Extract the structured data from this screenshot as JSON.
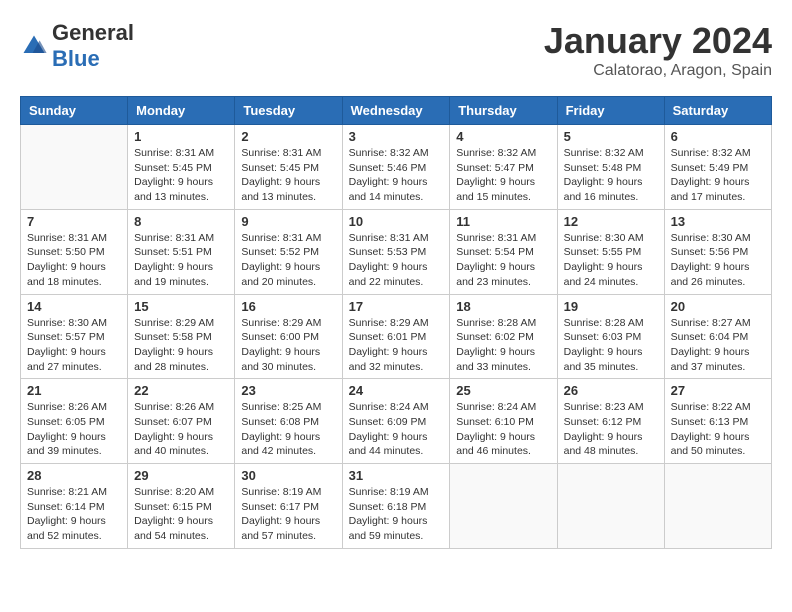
{
  "logo": {
    "general": "General",
    "blue": "Blue"
  },
  "header": {
    "month": "January 2024",
    "location": "Calatorao, Aragon, Spain"
  },
  "days_of_week": [
    "Sunday",
    "Monday",
    "Tuesday",
    "Wednesday",
    "Thursday",
    "Friday",
    "Saturday"
  ],
  "weeks": [
    [
      {
        "day": "",
        "info": ""
      },
      {
        "day": "1",
        "sunrise": "Sunrise: 8:31 AM",
        "sunset": "Sunset: 5:45 PM",
        "daylight": "Daylight: 9 hours and 13 minutes."
      },
      {
        "day": "2",
        "sunrise": "Sunrise: 8:31 AM",
        "sunset": "Sunset: 5:45 PM",
        "daylight": "Daylight: 9 hours and 13 minutes."
      },
      {
        "day": "3",
        "sunrise": "Sunrise: 8:32 AM",
        "sunset": "Sunset: 5:46 PM",
        "daylight": "Daylight: 9 hours and 14 minutes."
      },
      {
        "day": "4",
        "sunrise": "Sunrise: 8:32 AM",
        "sunset": "Sunset: 5:47 PM",
        "daylight": "Daylight: 9 hours and 15 minutes."
      },
      {
        "day": "5",
        "sunrise": "Sunrise: 8:32 AM",
        "sunset": "Sunset: 5:48 PM",
        "daylight": "Daylight: 9 hours and 16 minutes."
      },
      {
        "day": "6",
        "sunrise": "Sunrise: 8:32 AM",
        "sunset": "Sunset: 5:49 PM",
        "daylight": "Daylight: 9 hours and 17 minutes."
      }
    ],
    [
      {
        "day": "7",
        "sunrise": "Sunrise: 8:31 AM",
        "sunset": "Sunset: 5:50 PM",
        "daylight": "Daylight: 9 hours and 18 minutes."
      },
      {
        "day": "8",
        "sunrise": "Sunrise: 8:31 AM",
        "sunset": "Sunset: 5:51 PM",
        "daylight": "Daylight: 9 hours and 19 minutes."
      },
      {
        "day": "9",
        "sunrise": "Sunrise: 8:31 AM",
        "sunset": "Sunset: 5:52 PM",
        "daylight": "Daylight: 9 hours and 20 minutes."
      },
      {
        "day": "10",
        "sunrise": "Sunrise: 8:31 AM",
        "sunset": "Sunset: 5:53 PM",
        "daylight": "Daylight: 9 hours and 22 minutes."
      },
      {
        "day": "11",
        "sunrise": "Sunrise: 8:31 AM",
        "sunset": "Sunset: 5:54 PM",
        "daylight": "Daylight: 9 hours and 23 minutes."
      },
      {
        "day": "12",
        "sunrise": "Sunrise: 8:30 AM",
        "sunset": "Sunset: 5:55 PM",
        "daylight": "Daylight: 9 hours and 24 minutes."
      },
      {
        "day": "13",
        "sunrise": "Sunrise: 8:30 AM",
        "sunset": "Sunset: 5:56 PM",
        "daylight": "Daylight: 9 hours and 26 minutes."
      }
    ],
    [
      {
        "day": "14",
        "sunrise": "Sunrise: 8:30 AM",
        "sunset": "Sunset: 5:57 PM",
        "daylight": "Daylight: 9 hours and 27 minutes."
      },
      {
        "day": "15",
        "sunrise": "Sunrise: 8:29 AM",
        "sunset": "Sunset: 5:58 PM",
        "daylight": "Daylight: 9 hours and 28 minutes."
      },
      {
        "day": "16",
        "sunrise": "Sunrise: 8:29 AM",
        "sunset": "Sunset: 6:00 PM",
        "daylight": "Daylight: 9 hours and 30 minutes."
      },
      {
        "day": "17",
        "sunrise": "Sunrise: 8:29 AM",
        "sunset": "Sunset: 6:01 PM",
        "daylight": "Daylight: 9 hours and 32 minutes."
      },
      {
        "day": "18",
        "sunrise": "Sunrise: 8:28 AM",
        "sunset": "Sunset: 6:02 PM",
        "daylight": "Daylight: 9 hours and 33 minutes."
      },
      {
        "day": "19",
        "sunrise": "Sunrise: 8:28 AM",
        "sunset": "Sunset: 6:03 PM",
        "daylight": "Daylight: 9 hours and 35 minutes."
      },
      {
        "day": "20",
        "sunrise": "Sunrise: 8:27 AM",
        "sunset": "Sunset: 6:04 PM",
        "daylight": "Daylight: 9 hours and 37 minutes."
      }
    ],
    [
      {
        "day": "21",
        "sunrise": "Sunrise: 8:26 AM",
        "sunset": "Sunset: 6:05 PM",
        "daylight": "Daylight: 9 hours and 39 minutes."
      },
      {
        "day": "22",
        "sunrise": "Sunrise: 8:26 AM",
        "sunset": "Sunset: 6:07 PM",
        "daylight": "Daylight: 9 hours and 40 minutes."
      },
      {
        "day": "23",
        "sunrise": "Sunrise: 8:25 AM",
        "sunset": "Sunset: 6:08 PM",
        "daylight": "Daylight: 9 hours and 42 minutes."
      },
      {
        "day": "24",
        "sunrise": "Sunrise: 8:24 AM",
        "sunset": "Sunset: 6:09 PM",
        "daylight": "Daylight: 9 hours and 44 minutes."
      },
      {
        "day": "25",
        "sunrise": "Sunrise: 8:24 AM",
        "sunset": "Sunset: 6:10 PM",
        "daylight": "Daylight: 9 hours and 46 minutes."
      },
      {
        "day": "26",
        "sunrise": "Sunrise: 8:23 AM",
        "sunset": "Sunset: 6:12 PM",
        "daylight": "Daylight: 9 hours and 48 minutes."
      },
      {
        "day": "27",
        "sunrise": "Sunrise: 8:22 AM",
        "sunset": "Sunset: 6:13 PM",
        "daylight": "Daylight: 9 hours and 50 minutes."
      }
    ],
    [
      {
        "day": "28",
        "sunrise": "Sunrise: 8:21 AM",
        "sunset": "Sunset: 6:14 PM",
        "daylight": "Daylight: 9 hours and 52 minutes."
      },
      {
        "day": "29",
        "sunrise": "Sunrise: 8:20 AM",
        "sunset": "Sunset: 6:15 PM",
        "daylight": "Daylight: 9 hours and 54 minutes."
      },
      {
        "day": "30",
        "sunrise": "Sunrise: 8:19 AM",
        "sunset": "Sunset: 6:17 PM",
        "daylight": "Daylight: 9 hours and 57 minutes."
      },
      {
        "day": "31",
        "sunrise": "Sunrise: 8:19 AM",
        "sunset": "Sunset: 6:18 PM",
        "daylight": "Daylight: 9 hours and 59 minutes."
      },
      {
        "day": "",
        "info": ""
      },
      {
        "day": "",
        "info": ""
      },
      {
        "day": "",
        "info": ""
      }
    ]
  ]
}
